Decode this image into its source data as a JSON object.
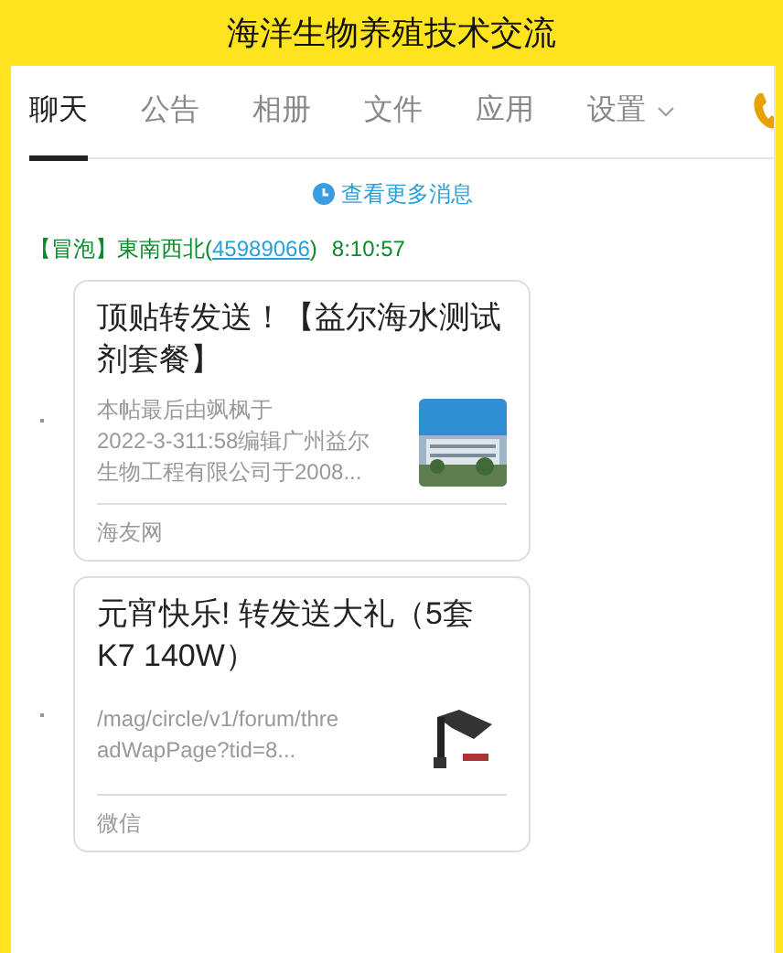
{
  "header": {
    "title": "海洋生物养殖技术交流"
  },
  "tabs": [
    {
      "label": "聊天",
      "selected": true,
      "kind": "tab"
    },
    {
      "label": "公告",
      "selected": false,
      "kind": "tab"
    },
    {
      "label": "相册",
      "selected": false,
      "kind": "tab"
    },
    {
      "label": "文件",
      "selected": false,
      "kind": "tab"
    },
    {
      "label": "应用",
      "selected": false,
      "kind": "tab"
    },
    {
      "label": "设置",
      "selected": false,
      "kind": "dropdown"
    }
  ],
  "more_messages": {
    "label": "查看更多消息"
  },
  "message": {
    "badge": "【冒泡】",
    "sender": "東南西北(",
    "sender_id": "45989066",
    "sender_close": ")",
    "time": "8:10:57"
  },
  "cards": [
    {
      "title_lines": [
        "顶贴转发送！【益尔海水测试",
        "剂套餐】"
      ],
      "summary_lines": [
        "本帖最后由飒枫于",
        "2022-3-311:58编辑广州益尔",
        "生物工程有限公司于2008..."
      ],
      "source": "海友网",
      "thumbnail": {
        "kind": "picture"
      }
    },
    {
      "title_lines": [
        "元宵快乐! 转发送大礼（5套",
        "K7 140W）"
      ],
      "summary_lines": [
        "/mag/circle/v1/forum/thre",
        "adWapPage?tid=8..."
      ],
      "source": "微信",
      "thumbnail": {
        "kind": "picture"
      }
    }
  ]
}
